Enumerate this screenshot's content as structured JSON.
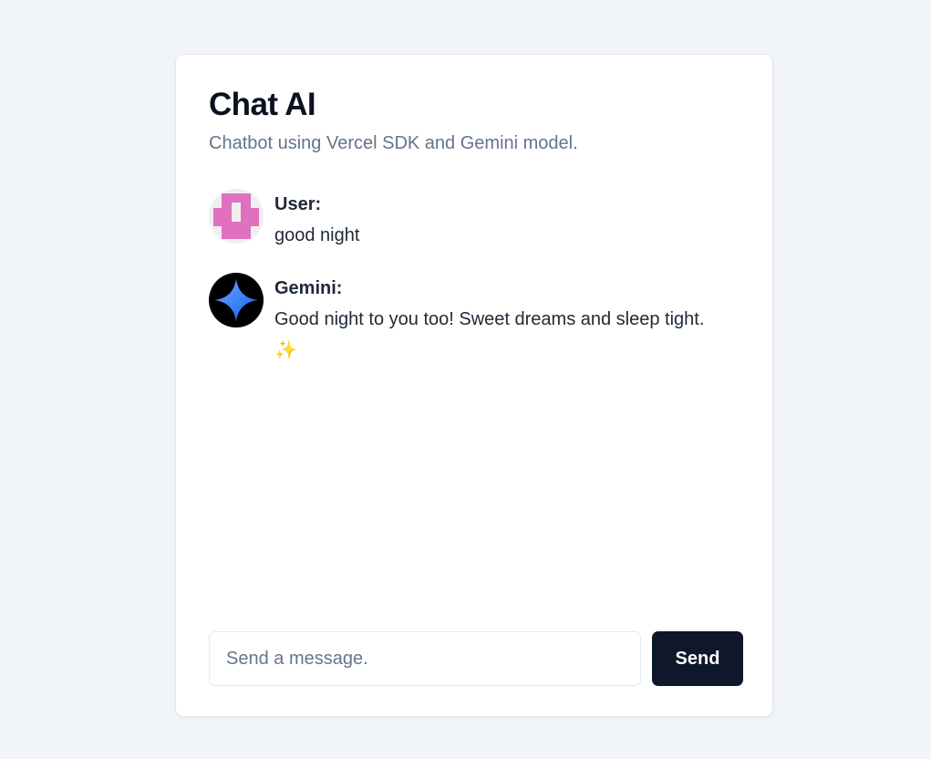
{
  "app": {
    "title": "Chat AI",
    "subtitle": "Chatbot using Vercel SDK and Gemini model."
  },
  "messages": [
    {
      "role_label": "User:",
      "text": "good night",
      "avatar_icon": "user-identicon-icon",
      "avatar_color": "#e070c0"
    },
    {
      "role_label": "Gemini:",
      "text": "Good night to you too! Sweet dreams and sleep tight. ✨",
      "avatar_icon": "gemini-sparkle-icon",
      "avatar_color": "#000000"
    }
  ],
  "composer": {
    "placeholder": "Send a message.",
    "value": "",
    "send_label": "Send"
  },
  "colors": {
    "page_background": "#f1f4f8",
    "card_background": "#ffffff",
    "send_button": "#0f172a",
    "subtitle_text": "#64748b"
  }
}
